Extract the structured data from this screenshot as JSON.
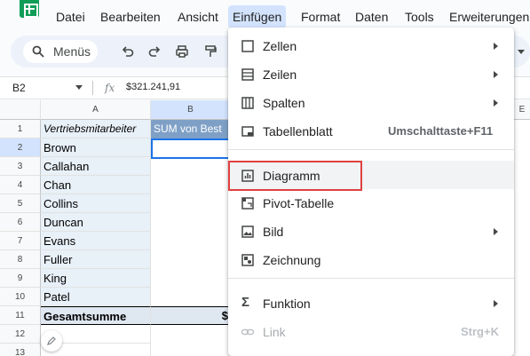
{
  "menubar": {
    "items": [
      "Datei",
      "Bearbeiten",
      "Ansicht",
      "Einfügen",
      "Format",
      "Daten",
      "Tools",
      "Erweiterungen"
    ]
  },
  "toolbar": {
    "search_label": "Menüs"
  },
  "formula_bar": {
    "cell_ref": "B2",
    "fx": "fx",
    "value": "$321.241,91"
  },
  "sheet": {
    "columns": [
      "A",
      "B",
      "E"
    ],
    "rows": [
      "1",
      "2",
      "3",
      "4",
      "5",
      "6",
      "7",
      "8",
      "9",
      "10",
      "11",
      "12",
      "13"
    ],
    "header_a": "Vertriebsmitarbeiter",
    "header_b": "SUM von Best",
    "names": [
      "Brown",
      "Callahan",
      "Chan",
      "Collins",
      "Duncan",
      "Evans",
      "Fuller",
      "King",
      "Patel"
    ],
    "total_label": "Gesamtsumme",
    "total_value_fragment": "$"
  },
  "dropdown": {
    "items": [
      {
        "label": "Zellen",
        "icon": "cell-icon",
        "submenu": true
      },
      {
        "label": "Zeilen",
        "icon": "rows-icon",
        "submenu": true
      },
      {
        "label": "Spalten",
        "icon": "columns-icon",
        "submenu": true
      },
      {
        "label": "Tabellenblatt",
        "icon": "sheet-icon",
        "shortcut": "Umschalttaste+F11"
      },
      {
        "label": "Diagramm",
        "icon": "chart-icon",
        "highlighted": true
      },
      {
        "label": "Pivot-Tabelle",
        "icon": "pivot-icon"
      },
      {
        "label": "Bild",
        "icon": "image-icon",
        "submenu": true
      },
      {
        "label": "Zeichnung",
        "icon": "drawing-icon"
      },
      {
        "label": "Funktion",
        "icon": "sigma-icon",
        "submenu": true
      },
      {
        "label": "Link",
        "icon": "link-icon",
        "shortcut": "Strg+K",
        "disabled": true
      }
    ]
  },
  "colors": {
    "highlight_box": "#e0413f",
    "header_b_bg": "#7fa0c6",
    "menu_active_bg": "#d3e3fd",
    "selected_cell_border": "#1a73e8"
  }
}
